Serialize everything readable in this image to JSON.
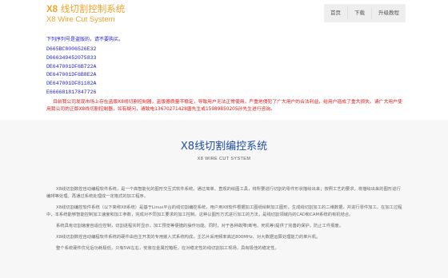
{
  "header": {
    "logo_prefix": "X8",
    "logo_title": "线切割控制系统",
    "logo_subtitle": "X8 Wire Cut System",
    "nav": [
      {
        "label": "首页"
      },
      {
        "label": "下载"
      },
      {
        "label": "升级教程"
      }
    ]
  },
  "notice": {
    "head": "下列序列号是盗版的，请不要购买。",
    "serials": [
      "D665BC8006526E32",
      "D666349452075833",
      "DE647001DF6B722A",
      "DE647001DF6B8E2A",
      "DE647001DF81182A",
      "E666681817847726"
    ],
    "warning": "目前我公司发现市场上存在盗版X8线切割控制器，盗版器质量不稳定，导致用户无法正常使用，严重地侵犯了广大用户的合法利益，给用户造成了重大损失。请广大用户使用我公司的正版X8线切割控制器，如有疑问，请致电13670271428唐先生或15989850205孙先生进行咨询。"
  },
  "section": {
    "title": "X8线切割编控系统",
    "subtitle": "X8 WIRE CUT SYSTEM",
    "paragraphs": [
      "X8线切割数控自动编程软件系统，是一个高智能化的图形交互式软件系统。通过简单、直观的绘图工具，将所要进行切割的零件形状描绘出来；按照工艺的要求，将描绘出来的图形进行编排等处理。再通过系统处理成一定格式的加工程序。",
      "X8线切割编控软件系统（以下简称X8系统）是基于Linux平台的线切割编控系统，用户用X8软件根据加工图纸绘制加工图形，生成线切割加工的二维数据，并进行零件加工。在加工过程中，本系统能够智能控制加工速度和加工参数，完成对不同加工要求的加工控制。这种以图形方式进行加工的方法，是线切割领域内的CAD和CAM系统的有机结合。",
      "系统具有切割速度自适应控制，切割进程实时显示，加工预览等便捷的操作功能。同时，对于各种故障(断电、死机等)提供了完善的保护，防止工件报废。",
      "X8线切割数控自动编程软件系统的硬件由自主开发的专用嵌入式系统构成，主芯片采用频率高达800MHz、对大数据运算处理能力的单片机。",
      "整个系统硬件优化后功耗极低，只有5W左右，安装在金属控箱柜，在对稳定性的线切割加工现场，具有极佳的稳定性。"
    ]
  },
  "colors": {
    "brand_orange": "#f0a22a",
    "link_blue": "#2222cc",
    "warning_red": "#e01818",
    "title_blue": "#1f4fa0"
  }
}
